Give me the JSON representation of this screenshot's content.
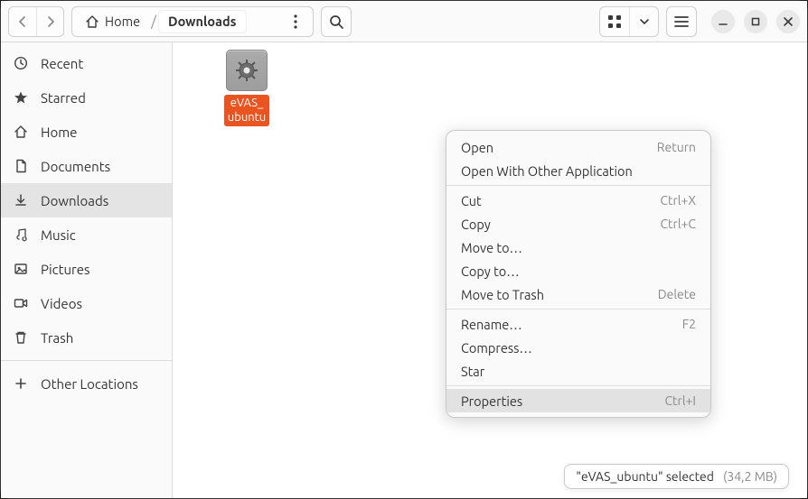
{
  "breadcrumb": {
    "home_label": "Home",
    "current_label": "Downloads"
  },
  "sidebar": {
    "items": [
      {
        "label": "Recent"
      },
      {
        "label": "Starred"
      },
      {
        "label": "Home"
      },
      {
        "label": "Documents"
      },
      {
        "label": "Downloads"
      },
      {
        "label": "Music"
      },
      {
        "label": "Pictures"
      },
      {
        "label": "Videos"
      },
      {
        "label": "Trash"
      }
    ],
    "other_locations_label": "Other Locations"
  },
  "file": {
    "name_line1": "eVAS_",
    "name_line2": "ubuntu"
  },
  "context_menu": {
    "items": [
      {
        "label": "Open",
        "shortcut": "Return"
      },
      {
        "label": "Open With Other Application",
        "shortcut": ""
      },
      {
        "sep": true
      },
      {
        "label": "Cut",
        "shortcut": "Ctrl+X"
      },
      {
        "label": "Copy",
        "shortcut": "Ctrl+C"
      },
      {
        "label": "Move to…",
        "shortcut": ""
      },
      {
        "label": "Copy to…",
        "shortcut": ""
      },
      {
        "label": "Move to Trash",
        "shortcut": "Delete"
      },
      {
        "sep": true
      },
      {
        "label": "Rename…",
        "shortcut": "F2"
      },
      {
        "label": "Compress…",
        "shortcut": ""
      },
      {
        "label": "Star",
        "shortcut": ""
      },
      {
        "sep": true
      },
      {
        "label": "Properties",
        "shortcut": "Ctrl+I",
        "hover": true
      }
    ]
  },
  "status_bar": {
    "text": "\"eVAS_ubuntu\" selected",
    "size": "(34,2 MB)"
  }
}
